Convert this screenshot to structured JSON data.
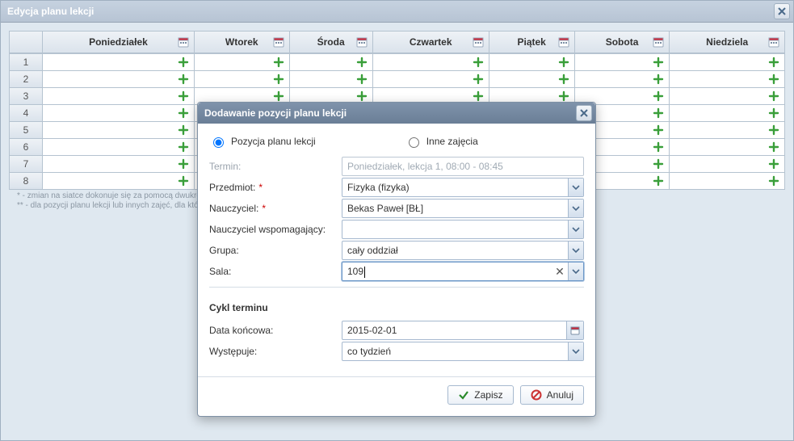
{
  "window_title": "Edycja planu lekcji",
  "days": [
    "Poniedziałek",
    "Wtorek",
    "Środa",
    "Czwartek",
    "Piątek",
    "Sobota",
    "Niedziela"
  ],
  "rows": [
    1,
    2,
    3,
    4,
    5,
    6,
    7,
    8
  ],
  "footnotes": {
    "l1": "* - zmian na siatce dokonuje się za pomocą dwukrotnego kliknięcia",
    "l2": "** - dla pozycji planu lekcji lub innych zajęć, dla których"
  },
  "modal": {
    "title": "Dodawanie pozycji planu lekcji",
    "radio_left": "Pozycja planu lekcji",
    "radio_right": "Inne zajęcia",
    "labels": {
      "termin": "Termin:",
      "przedmiot": "Przedmiot:",
      "nauczyciel": "Nauczyciel:",
      "nauczyciel_wsp": "Nauczyciel wspomagający:",
      "grupa": "Grupa:",
      "sala": "Sala:"
    },
    "values": {
      "termin": "Poniedziałek, lekcja 1, 08:00 - 08:45",
      "przedmiot": "Fizyka (fizyka)",
      "nauczyciel": "Bekas Paweł [BŁ]",
      "nauczyciel_wsp": "",
      "grupa": "cały oddział",
      "sala": "109"
    },
    "cycle": {
      "heading": "Cykl terminu",
      "end_date_label": "Data końcowa:",
      "end_date_value": "2015-02-01",
      "recur_label": "Występuje:",
      "recur_value": "co tydzień"
    },
    "buttons": {
      "save": "Zapisz",
      "cancel": "Anuluj"
    }
  }
}
